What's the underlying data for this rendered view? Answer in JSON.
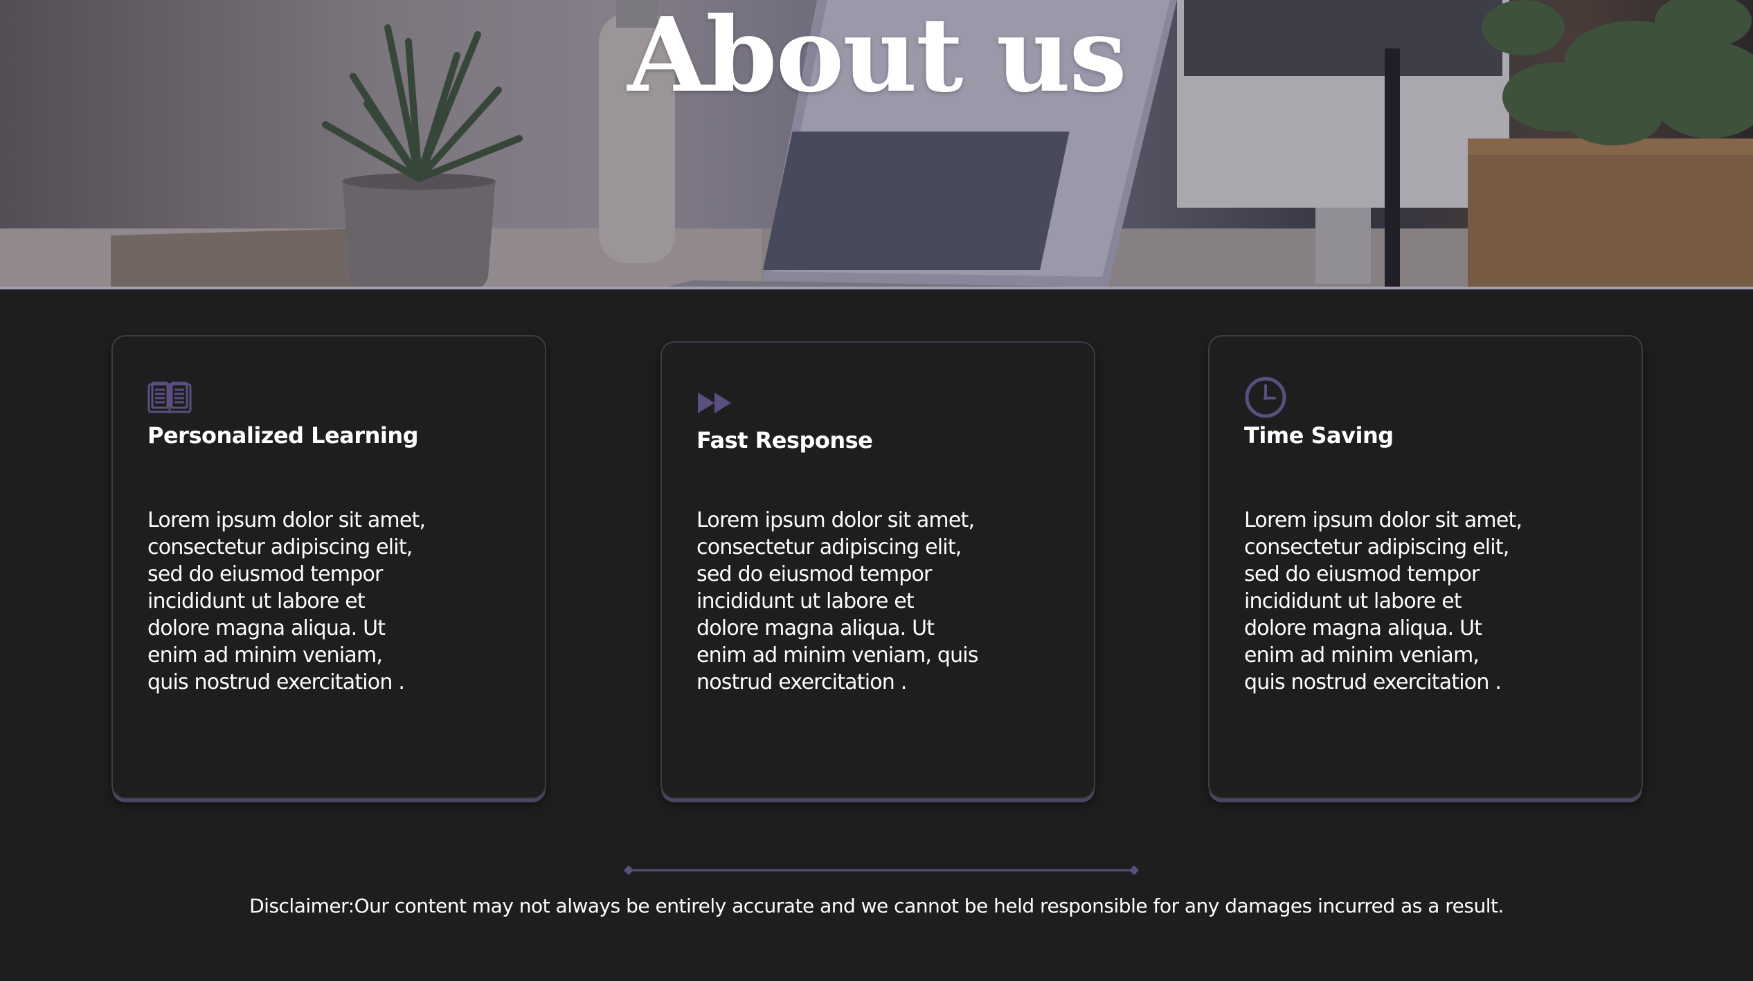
{
  "hero": {
    "title": "About us"
  },
  "cards": [
    {
      "icon": "open-book-icon",
      "title": "Personalized Learning",
      "body": "Lorem ipsum dolor sit amet,\nconsectetur adipiscing elit,\nsed do eiusmod tempor\nincididunt ut labore et\ndolore magna aliqua. Ut\nenim ad minim veniam,\nquis nostrud exercitation ."
    },
    {
      "icon": "fast-forward-icon",
      "title": "Fast Response",
      "body": "Lorem ipsum dolor sit amet,\nconsectetur adipiscing elit,\nsed do eiusmod tempor\nincididunt ut labore et\ndolore magna aliqua. Ut\nenim ad minim veniam, quis\nnostrud exercitation ."
    },
    {
      "icon": "clock-icon",
      "title": "Time Saving",
      "body": "Lorem ipsum dolor sit amet,\nconsectetur adipiscing elit,\nsed do eiusmod tempor\nincididunt ut labore et\ndolore magna aliqua. Ut\nenim ad minim veniam,\nquis nostrud exercitation ."
    }
  ],
  "footer": {
    "divider_icon": "diamond-line-divider",
    "disclaimer": "Disclaimer:Our content may not always be entirely accurate and we cannot be held responsible for any damages incurred as a result."
  },
  "colors": {
    "background": "#1e1e1f",
    "accent": "#5a4f80",
    "card_border": "#3e3b48",
    "text": "#ffffff"
  }
}
